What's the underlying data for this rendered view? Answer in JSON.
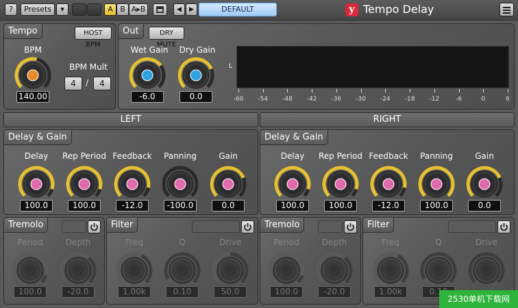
{
  "toolbar": {
    "help_label": "?",
    "presets_label": "Presets",
    "dropdown_glyph": "▾",
    "ab_a": "A",
    "ab_b": "B",
    "ab_copy": "A▸B",
    "nav_prev": "◀",
    "nav_next": "▶",
    "preset_name": "DEFAULT",
    "logo_glyph": "y",
    "app_title": "Tempo Delay",
    "accent_color": "#e6c233",
    "preset_color": "#9fcaf3"
  },
  "tempo": {
    "title": "Tempo",
    "host_bpm_label": "HOST BPM",
    "bpm_label": "BPM",
    "bpm_value": "140.00",
    "bpm_level": 0.55,
    "bpm_mult_label": "BPM Mult",
    "mult_num": "4",
    "mult_sep": "/",
    "mult_den": "4"
  },
  "out": {
    "title": "Out",
    "dry_mute_label": "DRY MUTE",
    "wet_label": "Wet Gain",
    "wet_value": "-6.0",
    "wet_level": 0.7,
    "dry_label": "Dry Gain",
    "dry_value": "0.0",
    "dry_level": 0.75,
    "meter_channel": "L",
    "meter_scale": [
      "-60",
      "-54",
      "-48",
      "-42",
      "-36",
      "-30",
      "-24",
      "-18",
      "-12",
      "-6",
      "0",
      "6"
    ]
  },
  "left": {
    "header": "LEFT",
    "delay_section": "Delay & Gain",
    "knobs": [
      {
        "label": "Delay",
        "value": "100.0",
        "level": 0.9
      },
      {
        "label": "Rep Period",
        "value": "100.0",
        "level": 0.9
      },
      {
        "label": "Feedback",
        "value": "-12.0",
        "level": 0.88
      },
      {
        "label": "Panning",
        "value": "-100.0",
        "level": 0.0
      },
      {
        "label": "Gain",
        "value": "0.0",
        "level": 0.75
      }
    ],
    "tremolo": {
      "title": "Tremolo",
      "knobs": [
        {
          "label": "Period",
          "value": "100.0",
          "level": 0.9
        },
        {
          "label": "Depth",
          "value": "-20.0",
          "level": 0.65
        }
      ]
    },
    "filter": {
      "title": "Filter",
      "knobs": [
        {
          "label": "Freq",
          "value": "1.00k",
          "level": 0.6
        },
        {
          "label": "Q",
          "value": "0.10",
          "level": 0.05
        },
        {
          "label": "Drive",
          "value": "50.0",
          "level": 0.5
        }
      ]
    }
  },
  "right": {
    "header": "RIGHT",
    "delay_section": "Delay & Gain",
    "knobs": [
      {
        "label": "Delay",
        "value": "100.0",
        "level": 0.9
      },
      {
        "label": "Rep Period",
        "value": "100.0",
        "level": 0.9
      },
      {
        "label": "Feedback",
        "value": "-12.0",
        "level": 0.88
      },
      {
        "label": "Panning",
        "value": "100.0",
        "level": 1.0
      },
      {
        "label": "Gain",
        "value": "0.0",
        "level": 0.75
      }
    ],
    "tremolo": {
      "title": "Tremolo",
      "knobs": [
        {
          "label": "Period",
          "value": "100.0",
          "level": 0.9
        },
        {
          "label": "Depth",
          "value": "-20.0",
          "level": 0.65
        }
      ]
    },
    "filter": {
      "title": "Filter",
      "knobs": [
        {
          "label": "Freq",
          "value": "1.00k",
          "level": 0.6
        },
        {
          "label": "Q",
          "value": "0.10",
          "level": 0.05
        },
        {
          "label": "Drive",
          "value": ""
        }
      ]
    }
  },
  "watermark": "2530单机下载网"
}
